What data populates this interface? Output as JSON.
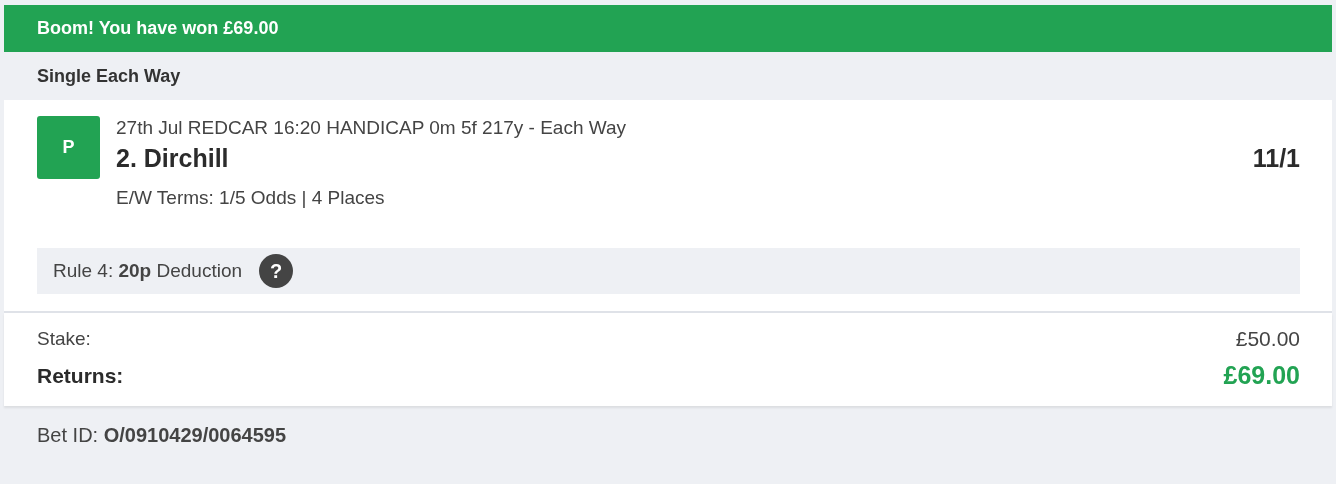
{
  "banner": {
    "text": "Boom! You have won £69.00"
  },
  "bet_type": "Single Each Way",
  "selection": {
    "badge": "P",
    "event": "27th Jul REDCAR 16:20 HANDICAP 0m 5f 217y - Each Way",
    "runner": "2. Dirchill",
    "odds": "11/1",
    "terms": "E/W Terms: 1/5 Odds | 4 Places"
  },
  "rule4": {
    "text": "Rule 4: **20p** Deduction",
    "help": "?"
  },
  "summary": [
    {
      "label": "Stake:",
      "value": "£50.00",
      "kind": "normal"
    },
    {
      "label": "Returns:",
      "value": "£69.00",
      "kind": "highlight"
    }
  ],
  "bet_id": "Bet ID: **O/0910429/0064595**"
}
